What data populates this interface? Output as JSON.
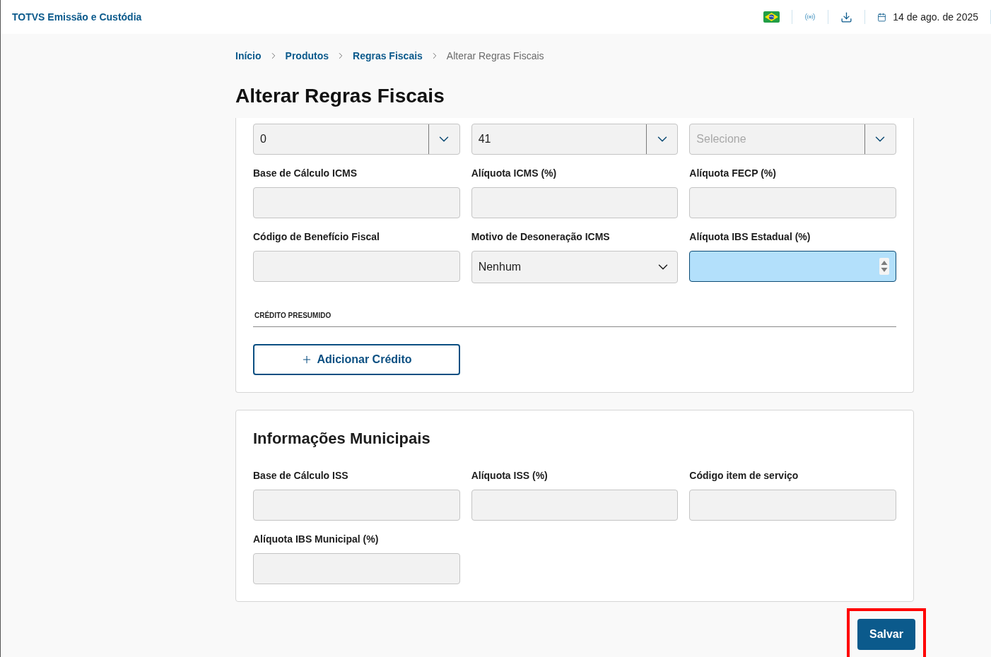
{
  "app_title": "TOTVS Emissão e Custódia",
  "header": {
    "date": "14 de ago. de 2025"
  },
  "breadcrumb": [
    {
      "label": "Início",
      "current": false
    },
    {
      "label": "Produtos",
      "current": false
    },
    {
      "label": "Regras Fiscais",
      "current": false
    },
    {
      "label": "Alterar Regras Fiscais",
      "current": true
    }
  ],
  "page_title": "Alterar Regras Fiscais",
  "fiscal_section": {
    "fields": [
      {
        "kind": "combo",
        "value": "0",
        "focused": false
      },
      {
        "kind": "combo",
        "value": "41",
        "focused": false
      },
      {
        "kind": "combo",
        "placeholder": "Selecione",
        "focused": false
      },
      {
        "kind": "text",
        "label": "Base de Cálculo ICMS",
        "focused": false
      },
      {
        "kind": "text",
        "label": "Alíquota ICMS (%)",
        "focused": false
      },
      {
        "kind": "text",
        "label": "Alíquota FECP (%)",
        "focused": false
      },
      {
        "kind": "text",
        "label": "Código de Benefício Fiscal",
        "focused": false
      },
      {
        "kind": "select",
        "label": "Motivo de Desoneração ICMS",
        "value": "Nenhum",
        "focused": false
      },
      {
        "kind": "number",
        "label": "Alíquota IBS Estadual (%)",
        "focused": true
      }
    ],
    "credit": {
      "title": "CRÉDITO PRESUMIDO",
      "add_button": "Adicionar Crédito"
    }
  },
  "municipal_section": {
    "title": "Informações Municipais",
    "fields": [
      {
        "kind": "text",
        "label": "Base de Cálculo ISS",
        "focused": false
      },
      {
        "kind": "text",
        "label": "Alíquota ISS (%)",
        "focused": false
      },
      {
        "kind": "text",
        "label": "Código item de serviço",
        "focused": false
      },
      {
        "kind": "text",
        "label": "Alíquota IBS Municipal (%)",
        "focused": false
      }
    ]
  },
  "save_button": {
    "label": "Salvar",
    "highlighted": true
  }
}
